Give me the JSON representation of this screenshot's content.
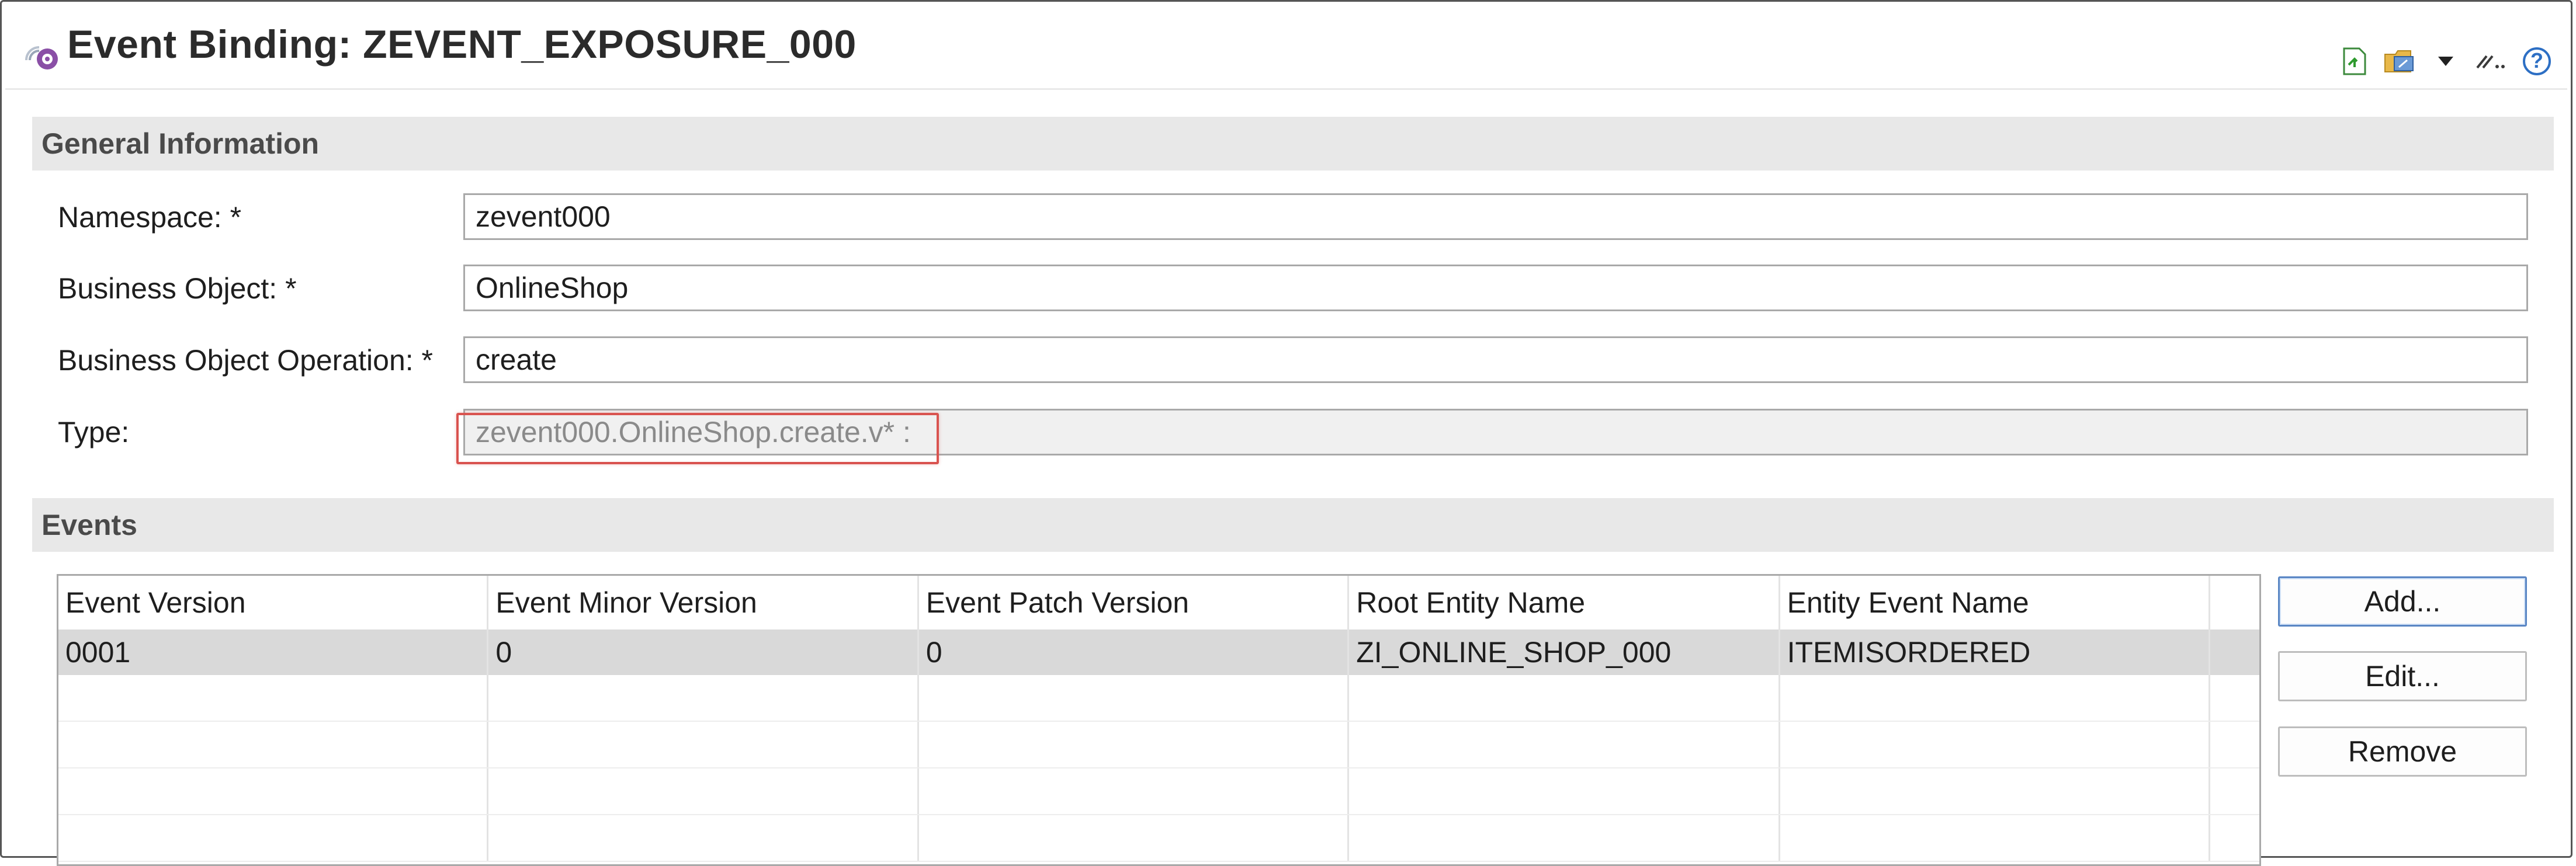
{
  "header": {
    "title": "Event Binding: ZEVENT_EXPOSURE_000",
    "icons": [
      "event-binding-icon",
      "export-icon",
      "share-icon",
      "dropdown-arrow-icon",
      "link-icon",
      "help-icon"
    ],
    "help_label": "?"
  },
  "general": {
    "section_title": "General Information",
    "namespace_label": "Namespace: *",
    "namespace_value": "zevent000",
    "business_object_label": "Business Object: *",
    "business_object_value": "OnlineShop",
    "operation_label": "Business Object Operation: *",
    "operation_value": "create",
    "type_label": "Type:",
    "type_value": "zevent000.OnlineShop.create.v* :"
  },
  "events": {
    "section_title": "Events",
    "columns": [
      "Event Version",
      "Event Minor Version",
      "Event Patch Version",
      "Root Entity Name",
      "Entity Event Name"
    ],
    "rows": [
      [
        "0001",
        "0",
        "0",
        "ZI_ONLINE_SHOP_000",
        "ITEMISORDERED"
      ]
    ],
    "buttons": {
      "add": "Add...",
      "edit": "Edit...",
      "remove": "Remove"
    }
  },
  "colors": {
    "section_bg": "#e8e8e8",
    "highlight": "#d9534f",
    "selected_row": "#d9d9d9",
    "default_button_border": "#5a86c4"
  }
}
